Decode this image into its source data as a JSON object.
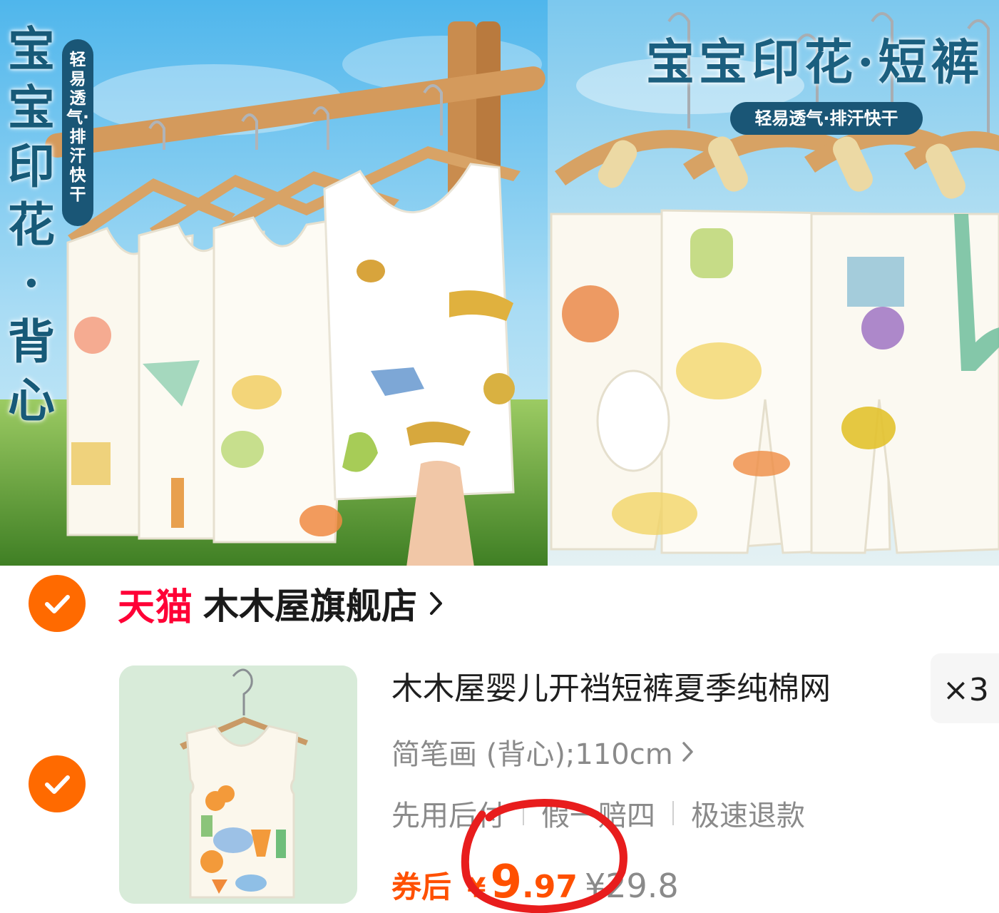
{
  "banner": {
    "left": {
      "vertical_title": "宝宝印花·背心",
      "pill_text": "轻易透气·排汗快干"
    },
    "right": {
      "title": "宝宝印花·短裤",
      "pill_text": "轻易透气·排汗快干"
    }
  },
  "store": {
    "badge": "天猫",
    "name": "木木屋旗舰店"
  },
  "item": {
    "title": "木木屋婴儿开裆短裤夏季纯棉网",
    "quantity": "×3",
    "sku": "简笔画 (背心);110cm",
    "tags": [
      "先用后付",
      "假一赔四",
      "极速退款"
    ],
    "coupon_label": "券后",
    "currency": "¥",
    "price_int": "9",
    "price_dec": ".97",
    "original_price": "¥29.8"
  },
  "colors": {
    "accent": "#ff5000",
    "check": "#ff6a00",
    "tmall": "#ff0036",
    "pill": "#1a5676",
    "annotation": "#e81d1d"
  }
}
